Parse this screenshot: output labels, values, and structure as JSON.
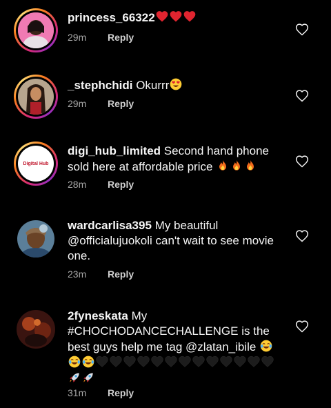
{
  "comments": [
    {
      "username": "princess_66322",
      "text": "",
      "emojis": [
        "red-heart",
        "red-heart",
        "red-heart"
      ],
      "time": "29m",
      "reply_label": "Reply",
      "has_story_ring": true
    },
    {
      "username": "_stephchidi",
      "text": "Okurrr",
      "emojis": [
        "heart-eyes"
      ],
      "time": "29m",
      "reply_label": "Reply",
      "has_story_ring": true
    },
    {
      "username": "digi_hub_limited",
      "text": "Second hand phone sold here at affordable price",
      "emojis": [
        "fire",
        "fire",
        "fire"
      ],
      "time": "28m",
      "reply_label": "Reply",
      "has_story_ring": true,
      "avatar_text": "Digital Hub"
    },
    {
      "username": "wardcarlisa395",
      "text": "My beautiful @officialujuokoli can't wait to see movie one.",
      "emojis": [],
      "time": "23m",
      "reply_label": "Reply",
      "has_story_ring": false
    },
    {
      "username": "2fyneskata",
      "text": "My #CHOCHODANCECHALLENGE is the best guys help me tag @zlatan_ibile",
      "emojis": [
        "joy",
        "joy",
        "joy",
        "black-heart",
        "black-heart",
        "black-heart",
        "black-heart",
        "black-heart",
        "black-heart",
        "black-heart",
        "black-heart",
        "black-heart",
        "black-heart",
        "black-heart",
        "black-heart",
        "black-heart",
        "rocket",
        "rocket"
      ],
      "time": "31m",
      "reply_label": "Reply",
      "has_story_ring": false
    }
  ],
  "icons": {
    "like": "heart-outline-icon"
  },
  "colors": {
    "background": "#000000",
    "meta": "#a8a8a8",
    "heart_red": "#e0242f"
  }
}
